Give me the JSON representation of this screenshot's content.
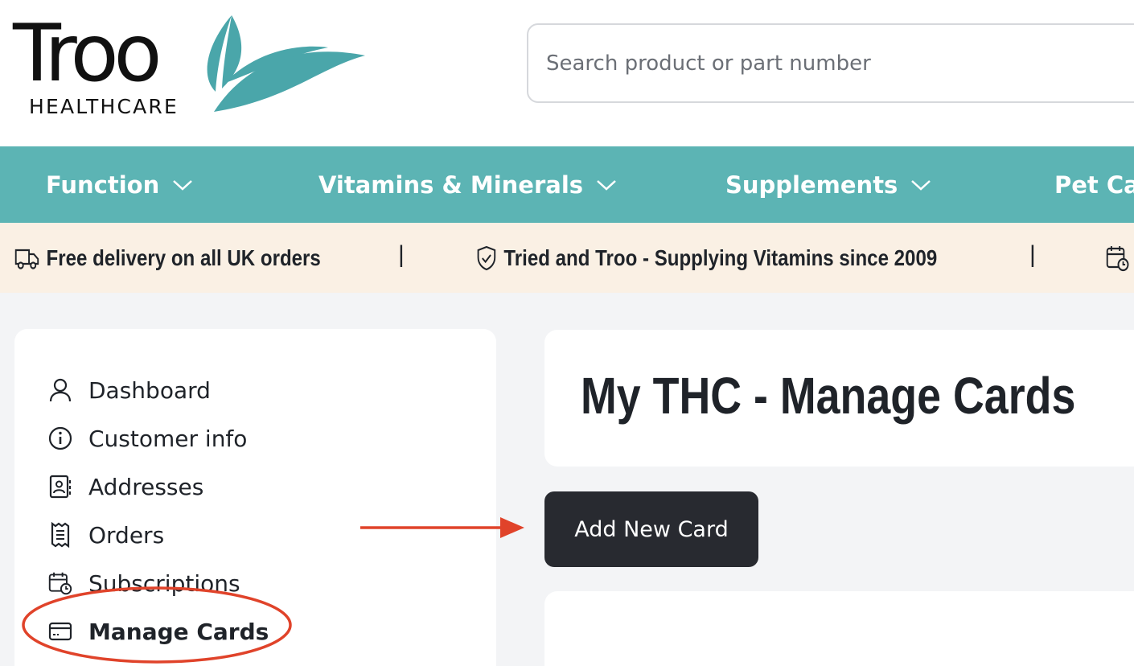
{
  "brand": {
    "name": "Troo",
    "tagline": "HEALTHCARE",
    "leaf_color": "#4aa6aa"
  },
  "search": {
    "placeholder": "Search product or part number"
  },
  "nav": {
    "items": [
      {
        "label": "Function"
      },
      {
        "label": "Vitamins & Minerals"
      },
      {
        "label": "Supplements"
      },
      {
        "label": "Pet Ca"
      }
    ],
    "background": "#5cb4b4"
  },
  "infobar": {
    "items": [
      {
        "label": "Free delivery on all UK orders",
        "icon": "delivery-truck-icon"
      },
      {
        "label": "Tried and Troo - Supplying Vitamins since 2009",
        "icon": "shield-check-icon"
      },
      {
        "label": "",
        "icon": "calendar-clock-icon"
      }
    ],
    "separator": "|",
    "background": "#faf0e4"
  },
  "sidebar": {
    "items": [
      {
        "label": "Dashboard",
        "icon": "user-icon"
      },
      {
        "label": "Customer info",
        "icon": "info-icon"
      },
      {
        "label": "Addresses",
        "icon": "address-book-icon"
      },
      {
        "label": "Orders",
        "icon": "receipt-icon"
      },
      {
        "label": "Subscriptions",
        "icon": "calendar-clock-icon"
      },
      {
        "label": "Manage Cards",
        "icon": "credit-card-icon",
        "active": true
      }
    ]
  },
  "main": {
    "title": "My THC - Manage Cards",
    "add_card_label": "Add New Card"
  },
  "annotation": {
    "color": "#e0432a"
  }
}
